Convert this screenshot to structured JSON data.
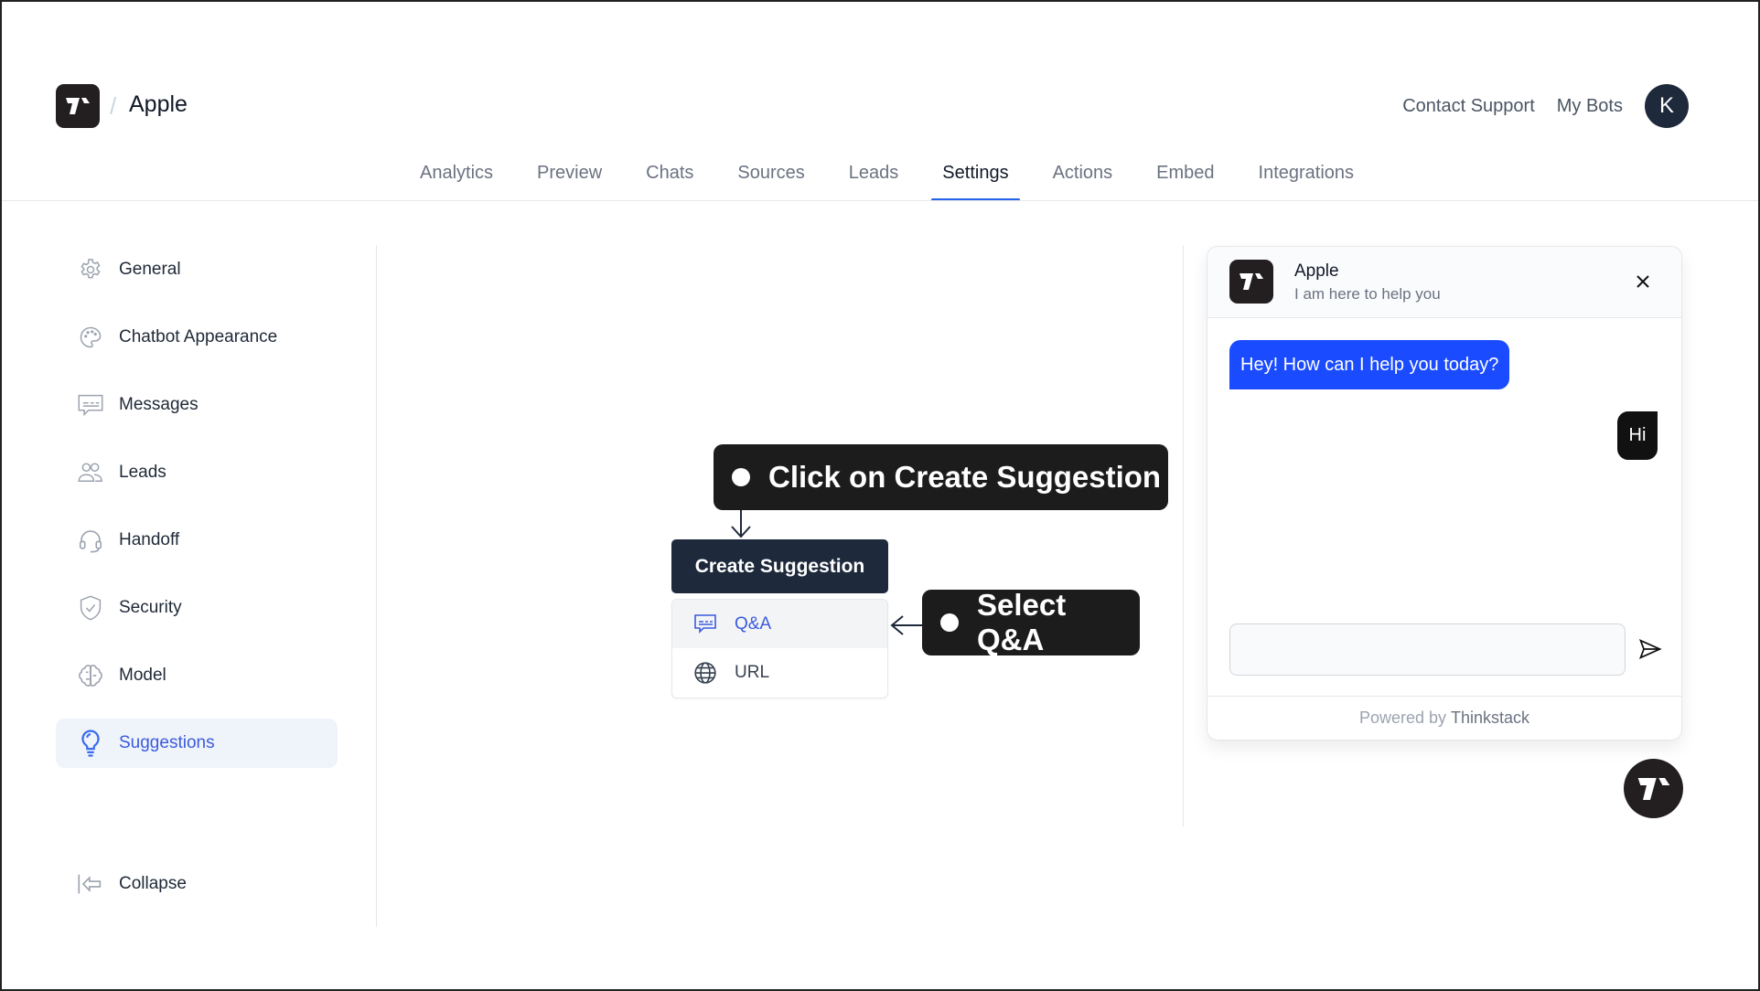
{
  "header": {
    "brand": "Apple",
    "separator": "/",
    "contact_support": "Contact Support",
    "my_bots": "My Bots",
    "avatar_initial": "K"
  },
  "nav": {
    "tabs": [
      {
        "label": "Analytics",
        "active": false
      },
      {
        "label": "Preview",
        "active": false
      },
      {
        "label": "Chats",
        "active": false
      },
      {
        "label": "Sources",
        "active": false
      },
      {
        "label": "Leads",
        "active": false
      },
      {
        "label": "Settings",
        "active": true
      },
      {
        "label": "Actions",
        "active": false
      },
      {
        "label": "Embed",
        "active": false
      },
      {
        "label": "Integrations",
        "active": false
      }
    ]
  },
  "sidebar": {
    "items": [
      {
        "label": "General",
        "icon": "gear-icon"
      },
      {
        "label": "Chatbot Appearance",
        "icon": "palette-icon"
      },
      {
        "label": "Messages",
        "icon": "message-icon"
      },
      {
        "label": "Leads",
        "icon": "users-icon"
      },
      {
        "label": "Handoff",
        "icon": "headset-icon"
      },
      {
        "label": "Security",
        "icon": "shield-check-icon"
      },
      {
        "label": "Model",
        "icon": "brain-icon"
      },
      {
        "label": "Suggestions",
        "icon": "lightbulb-icon",
        "active": true
      }
    ],
    "collapse": "Collapse"
  },
  "main": {
    "callout_create": "Click on Create Suggestion",
    "callout_select": "Select Q&A",
    "create_button": "Create Suggestion",
    "menu": [
      {
        "label": "Q&A",
        "icon": "message-icon",
        "highlighted": true
      },
      {
        "label": "URL",
        "icon": "globe-icon",
        "highlighted": false
      }
    ]
  },
  "chat": {
    "name": "Apple",
    "subtitle": "I am here to help you",
    "bot_message": "Hey! How can I help you today?",
    "user_message": "Hi",
    "input_value": "",
    "input_placeholder": "",
    "powered_by": "Powered by",
    "powered_brand": "Thinkstack"
  },
  "colors": {
    "accent": "#2563eb",
    "bot_bubble": "#1a4bff",
    "button_dark": "#1e293b",
    "callout_bg": "#1c1c1c"
  }
}
